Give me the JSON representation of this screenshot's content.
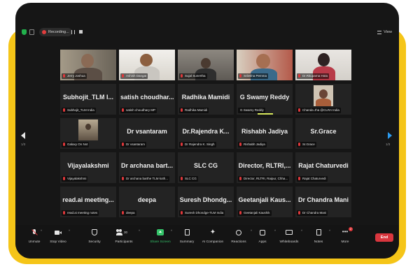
{
  "colors": {
    "accent_frame": "#f5c518",
    "device_bg": "#161616",
    "tile_bg": "#232323",
    "speaker_highlight": "#d8e85c",
    "end_button": "#d9363e",
    "share_green": "#35c46a",
    "next_arrow": "#2c9bf0"
  },
  "topbar": {
    "recording_label": "Recording...",
    "view_label": "View",
    "icons": [
      "security-shield-icon",
      "info-icon",
      "record-dot-icon",
      "pause-icon",
      "stop-icon",
      "grid-view-icon"
    ]
  },
  "pagination": {
    "left": "1/3",
    "right": "1/3"
  },
  "participants": [
    {
      "label": "Jerry Joshua",
      "display": "",
      "video": true
    },
    {
      "label": "Ashish Dangat",
      "display": "",
      "video": true
    },
    {
      "label": "Sujal Sunertha",
      "display": "",
      "video": true
    },
    {
      "label": "Srilekha Pemma",
      "display": "",
      "video": true,
      "active": true
    },
    {
      "label": "Dr.Rituparna Hota",
      "display": "",
      "video": true
    },
    {
      "label": "Subhojit_TLM India",
      "display": "Subhojit_TLM I...",
      "video": false
    },
    {
      "label": "satish choudhary MP",
      "display": "satish choudhar...",
      "video": false
    },
    {
      "label": "Radhika Mamidi",
      "display": "Radhika Mamidi",
      "video": false
    },
    {
      "label": "G Swamy Reddy",
      "display": "G Swamy Reddy",
      "video": false,
      "speaking": true
    },
    {
      "label": "Chanda Jha @CLRA India",
      "display": "",
      "video": false,
      "photo": true
    },
    {
      "label": "Galaxy On Nxt",
      "display": "",
      "video": false,
      "photo": true
    },
    {
      "label": "Dr vsantaram",
      "display": "Dr vsantaram",
      "video": false
    },
    {
      "label": "Dr Rajendra K. Singh",
      "display": "Dr.Rajendra K...",
      "video": false
    },
    {
      "label": "Rishabh Jadiya",
      "display": "Rishabh Jadiya",
      "video": false
    },
    {
      "label": "Sr.Grace",
      "display": "Sr.Grace",
      "video": false
    },
    {
      "label": "Vijayalakshmi",
      "display": "Vijayalakshmi",
      "video": false
    },
    {
      "label": "Dr archana barthe TLM koth...",
      "display": "Dr archana bart...",
      "video": false
    },
    {
      "label": "SLC CG",
      "display": "SLC CG",
      "video": false
    },
    {
      "label": "Director, RLTRI, Raipur, Chha...",
      "display": "Director, RLTRI,...",
      "video": false
    },
    {
      "label": "Rajat Chaturvedi",
      "display": "Rajat Chaturvedi",
      "video": false
    },
    {
      "label": "read.ai meeting notes",
      "display": "read.ai meeting...",
      "video": false
    },
    {
      "label": "deepa",
      "display": "deepa",
      "video": false
    },
    {
      "label": "Suresh Dhondge-TLM India",
      "display": "Suresh Dhondg...",
      "video": false
    },
    {
      "label": "Geetanjali Kaushik",
      "display": "Geetanjali Kaus...",
      "video": false
    },
    {
      "label": "Dr Chandra Mani",
      "display": "Dr Chandra Mani",
      "video": false
    }
  ],
  "toolbar": {
    "unmute": "Unmute",
    "stop_video": "Stop Video",
    "security": "Security",
    "participants": "Participants",
    "participants_count": "30",
    "share_screen": "Share Screen",
    "summary": "Summary",
    "ai_companion": "AI Companion",
    "reactions": "Reactions",
    "apps": "Apps",
    "whiteboards": "Whiteboards",
    "notes": "Notes",
    "more": "More",
    "more_badge": "2",
    "end": "End",
    "caret": "^"
  }
}
